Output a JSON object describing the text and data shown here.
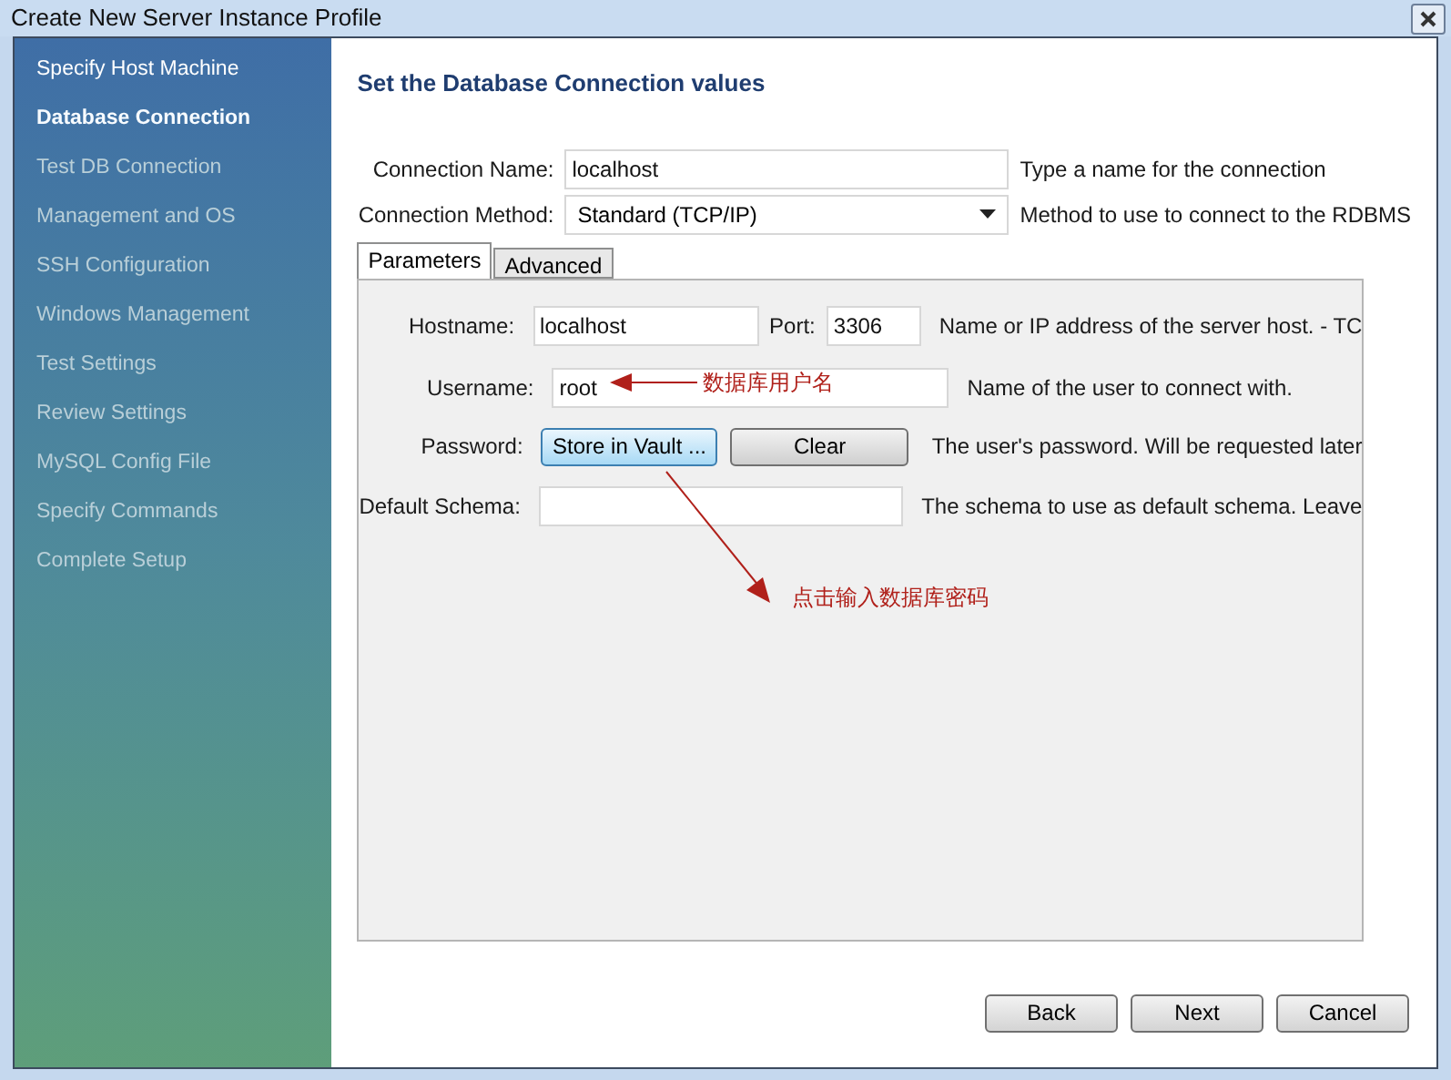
{
  "window": {
    "title": "Create New Server Instance Profile"
  },
  "steps": [
    {
      "label": "Specify Host Machine",
      "selected": false,
      "completed": true
    },
    {
      "label": "Database Connection",
      "selected": true,
      "completed": false
    },
    {
      "label": "Test DB Connection",
      "selected": false,
      "completed": false
    },
    {
      "label": "Management and OS",
      "selected": false,
      "completed": false
    },
    {
      "label": "SSH Configuration",
      "selected": false,
      "completed": false
    },
    {
      "label": "Windows Management",
      "selected": false,
      "completed": false
    },
    {
      "label": "Test Settings",
      "selected": false,
      "completed": false
    },
    {
      "label": "Review Settings",
      "selected": false,
      "completed": false
    },
    {
      "label": "MySQL Config File",
      "selected": false,
      "completed": false
    },
    {
      "label": "Specify Commands",
      "selected": false,
      "completed": false
    },
    {
      "label": "Complete Setup",
      "selected": false,
      "completed": false
    }
  ],
  "heading": "Set the Database Connection values",
  "connection_name": {
    "label": "Connection Name:",
    "value": "localhost",
    "hint": "Type a name for the connection"
  },
  "connection_method": {
    "label": "Connection Method:",
    "value": "Standard (TCP/IP)",
    "hint": "Method to use to connect to the RDBMS"
  },
  "tabs": [
    {
      "label": "Parameters",
      "selected": true
    },
    {
      "label": "Advanced",
      "selected": false
    }
  ],
  "hostname": {
    "label": "Hostname:",
    "value": "localhost",
    "port_label": "Port:",
    "port": "3306",
    "hint": "Name or IP address of the server host. - TC"
  },
  "username": {
    "label": "Username:",
    "value": "root",
    "hint": "Name of the user to connect with."
  },
  "password": {
    "label": "Password:",
    "store_button": "Store in Vault ...",
    "clear_button": "Clear",
    "hint": "The user's password. Will be requested later"
  },
  "default_schema": {
    "label": "Default Schema:",
    "hint": "The schema to use as default schema. Leave"
  },
  "annotations": [
    "数据库用户名",
    "点击输入数据库密码"
  ],
  "buttons": [
    "Back",
    "Next",
    "Cancel"
  ]
}
